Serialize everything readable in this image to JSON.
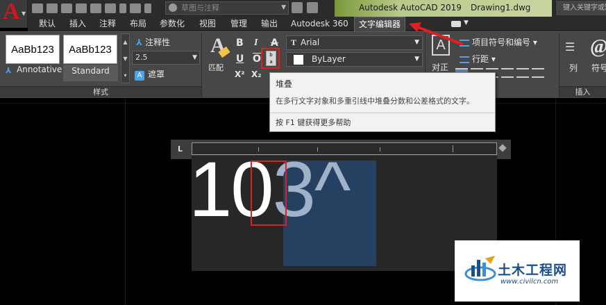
{
  "titlebar": {
    "workspace_placeholder": "草图与注释",
    "app_title": "Autodesk AutoCAD 2019",
    "doc_title": "Drawing1.dwg",
    "search_placeholder": "键入关键字或短语"
  },
  "tabs": [
    {
      "label": "默认"
    },
    {
      "label": "插入"
    },
    {
      "label": "注释"
    },
    {
      "label": "布局"
    },
    {
      "label": "参数化"
    },
    {
      "label": "视图"
    },
    {
      "label": "管理"
    },
    {
      "label": "输出"
    },
    {
      "label": "Autodesk 360"
    },
    {
      "label": "文字编辑器",
      "active": true
    }
  ],
  "ribbon": {
    "style_panel": {
      "swatches": [
        {
          "preview": "AaBb123",
          "name": "Annotative"
        },
        {
          "preview": "AaBb123",
          "name": "Standard"
        }
      ],
      "annotative_toggle": "注释性",
      "text_height": "2.5",
      "mask_button": "遮罩",
      "panel_title": "样式"
    },
    "format_panel": {
      "match_label": "匹配",
      "bold": "B",
      "italic": "I",
      "strike": "A",
      "underline": "U",
      "overline": "O",
      "superscript": "X²",
      "subscript": "X₂",
      "font_name": "Arial",
      "color_name": "ByLayer",
      "font_prefix_icon": "T"
    },
    "paragraph_panel": {
      "justify_label": "对正",
      "list_label": "项目符号和编号",
      "spacing_label": "行距"
    },
    "insert_panel": {
      "column_label": "列",
      "symbol_label": "符号",
      "panel_title": "插入"
    }
  },
  "tooltip": {
    "title": "堆叠",
    "description": "在多行文字对象和多重引线中堆叠分数和公差格式的文字。",
    "help": "按 F1 键获得更多帮助"
  },
  "editor": {
    "text_normal": "10",
    "text_selected": "3^"
  },
  "watermark": {
    "name": "土木工程网",
    "url": "www.civilcn.com"
  },
  "colors": {
    "accent_red": "#e02020",
    "title_green": "#b8c98a",
    "selection_blue": "#264062"
  }
}
